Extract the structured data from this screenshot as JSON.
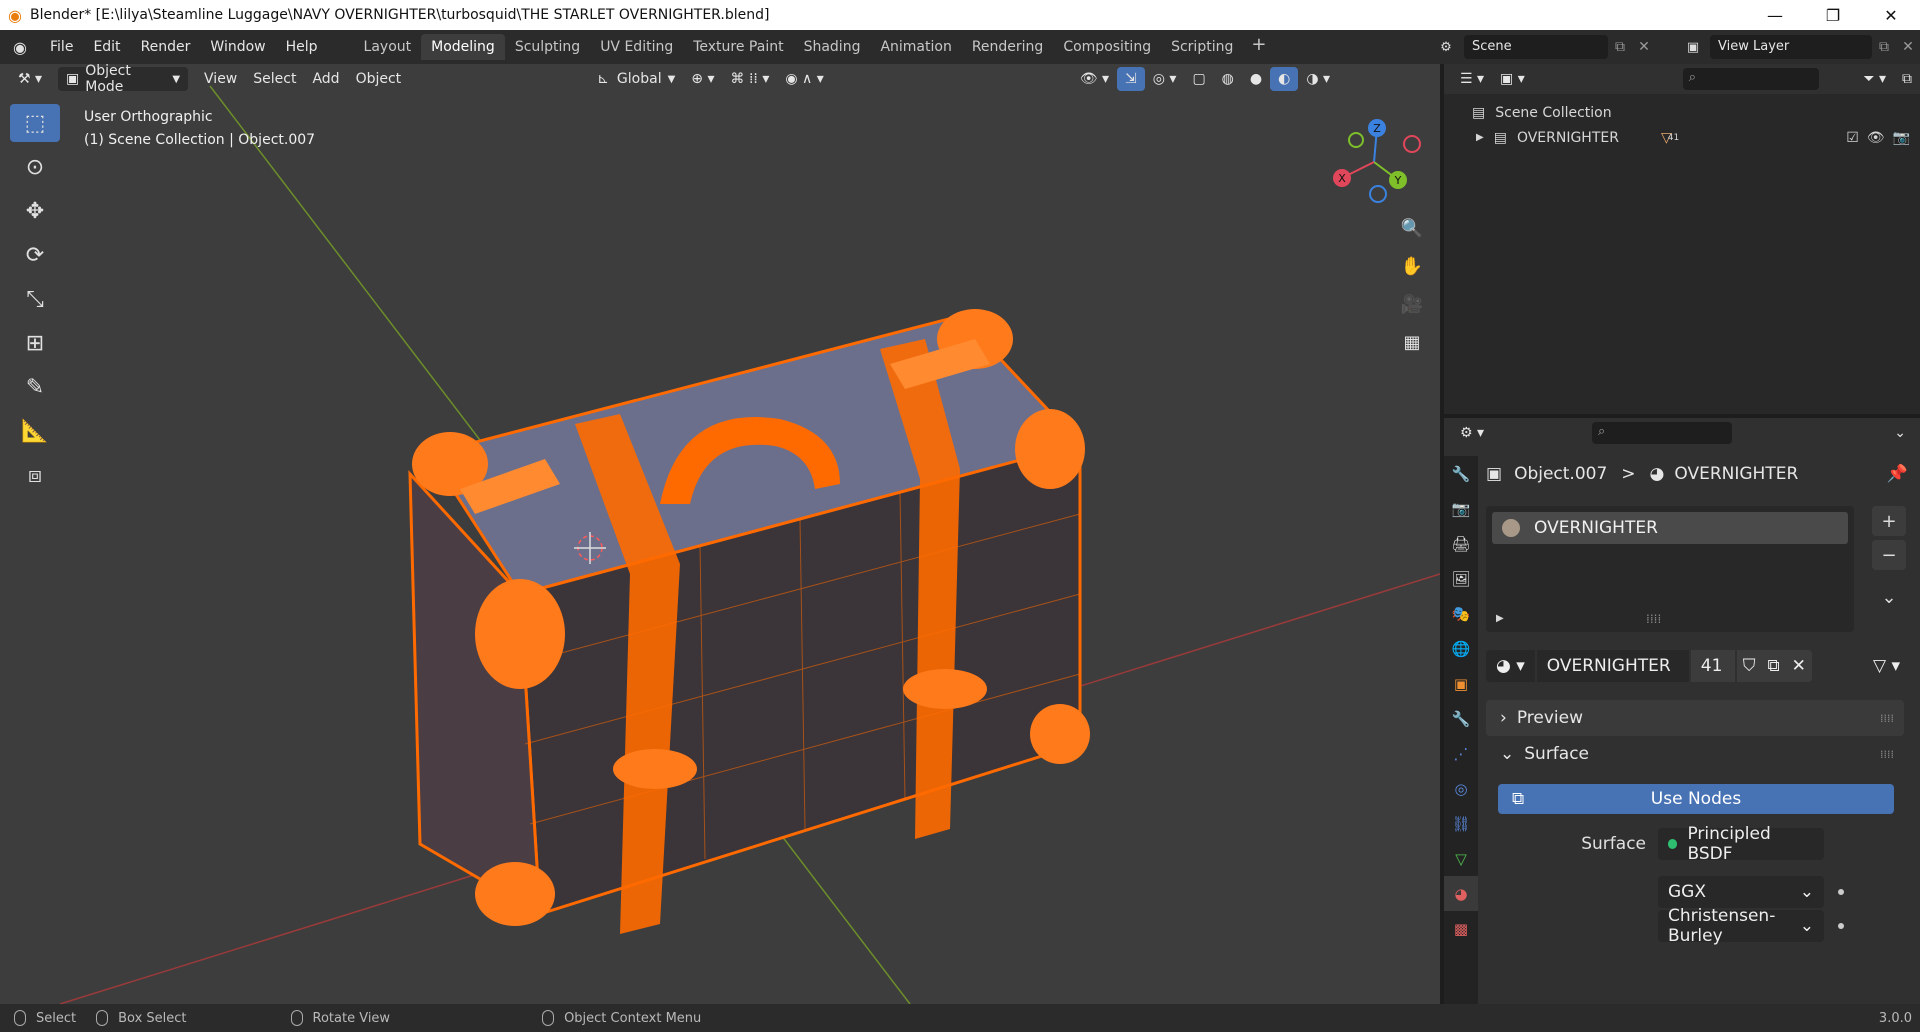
{
  "window": {
    "title": "Blender* [E:\\lilya\\Steamline Luggage\\NAVY OVERNIGHTER\\turbosquid\\THE STARLET OVERNIGHTER.blend]",
    "minimize": "—",
    "restore": "❐",
    "close": "✕"
  },
  "menu": [
    "File",
    "Edit",
    "Render",
    "Window",
    "Help"
  ],
  "workspaces": [
    "Layout",
    "Modeling",
    "Sculpting",
    "UV Editing",
    "Texture Paint",
    "Shading",
    "Animation",
    "Rendering",
    "Compositing",
    "Scripting"
  ],
  "active_workspace": "Modeling",
  "add_workspace": "+",
  "scene": {
    "name": "Scene"
  },
  "view_layer": {
    "name": "View Layer"
  },
  "viewport": {
    "mode": "Object Mode",
    "menus": [
      "View",
      "Select",
      "Add",
      "Object"
    ],
    "orientation": "Global",
    "view_name": "User Orthographic",
    "context": "(1) Scene Collection | Object.007",
    "gizmo_axes": {
      "x": "X",
      "y": "Y",
      "z": "Z"
    }
  },
  "outliner": {
    "root": "Scene Collection",
    "collection": "OVERNIGHTER",
    "badge": "41"
  },
  "properties": {
    "breadcrumb_object": "Object.007",
    "breadcrumb_sep": ">",
    "breadcrumb_material": "OVERNIGHTER",
    "slot_name": "OVERNIGHTER",
    "material_name": "OVERNIGHTER",
    "user_count": "41",
    "preview_label": "Preview",
    "surface_panel_label": "Surface",
    "use_nodes_label": "Use Nodes",
    "surface_label": "Surface",
    "surface_value": "Principled BSDF",
    "distribution": "GGX",
    "subsurface_method": "Christensen-Burley"
  },
  "statusbar": {
    "select": "Select",
    "box_select": "Box Select",
    "rotate_view": "Rotate View",
    "context_menu": "Object Context Menu",
    "version": "3.0.0"
  },
  "colors": {
    "selection_orange": "#ff6a00",
    "active_blue": "#4772b3",
    "viewport_bg": "#3d3d3d"
  }
}
